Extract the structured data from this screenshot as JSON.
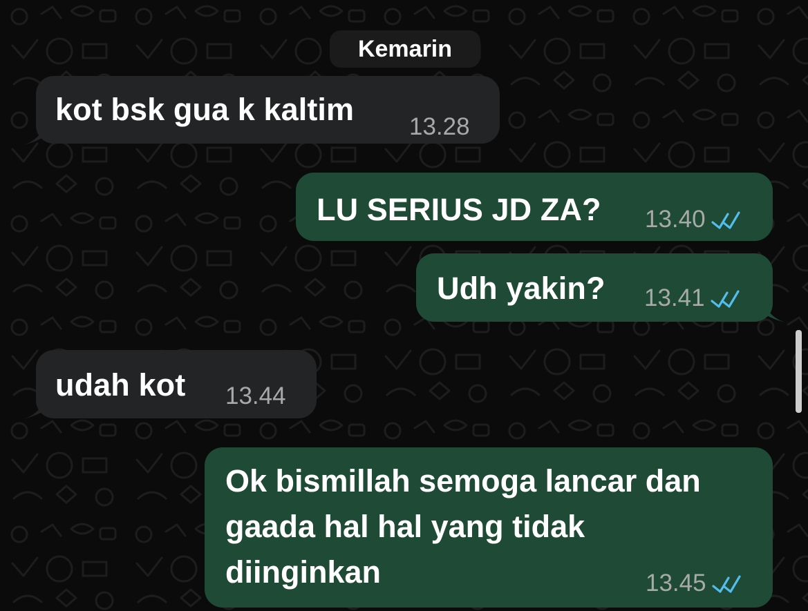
{
  "chat": {
    "date_label": "Kemarin",
    "messages": [
      {
        "direction": "incoming",
        "text": "kot bsk gua k kaltim",
        "time": "13.28",
        "status_icon": ""
      },
      {
        "direction": "outgoing",
        "text": "LU SERIUS JD ZA?",
        "time": "13.40",
        "status_icon": "double-check-icon"
      },
      {
        "direction": "outgoing",
        "text": "Udh yakin?",
        "time": "13.41",
        "status_icon": "double-check-icon"
      },
      {
        "direction": "incoming",
        "text": "udah kot",
        "time": "13.44",
        "status_icon": ""
      },
      {
        "direction": "outgoing",
        "text": "Ok bismillah semoga lancar dan gaada hal hal yang tidak diinginkan",
        "lines": [
          "Ok bismillah semoga lancar dan",
          "gaada hal hal yang tidak",
          "diinginkan"
        ],
        "time": "13.45",
        "status_icon": "double-check-icon"
      }
    ]
  },
  "theme": {
    "background": "#0b0b0b",
    "incoming_bubble": "#232425",
    "outgoing_bubble": "#1f4a35",
    "text": "#ffffff",
    "timestamp": "#a7aaa8",
    "read_receipt": "#53bdeb",
    "date_chip": "#1b1b1b"
  }
}
